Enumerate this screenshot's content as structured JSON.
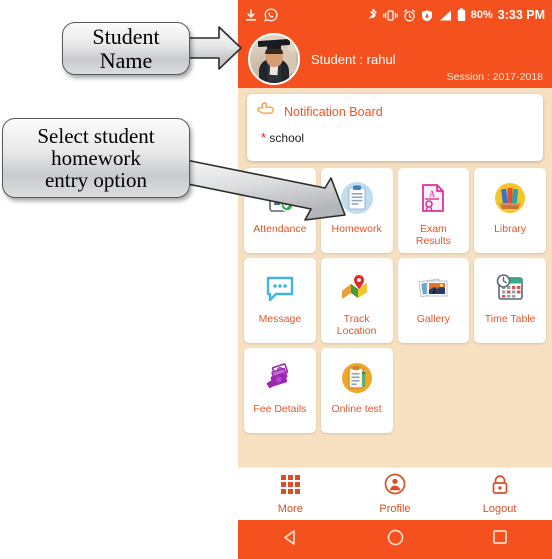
{
  "annotations": [
    {
      "id": "student-name",
      "text": "Student\nName"
    },
    {
      "id": "homework-option",
      "text": "Select student\nhomework\nentry option"
    }
  ],
  "phone": {
    "statusbar": {
      "left_icons": [
        "download-icon",
        "whatsapp-icon"
      ],
      "right_icons": [
        "bluetooth-icon",
        "vibrate-icon",
        "alarm-icon",
        "location-icon",
        "signal-icon",
        "battery-icon"
      ],
      "battery": "80%",
      "time": "3:33 PM"
    },
    "header": {
      "avatar": "graduate-photo",
      "student_label": "Student : rahul",
      "session_label": "Session : 2017-2018",
      "background_color": "#f4511e"
    },
    "notification_board": {
      "icon": "pointing-hand-icon",
      "title": "Notification Board",
      "items": [
        {
          "bullet": "*",
          "text": "school"
        }
      ]
    },
    "tiles": [
      {
        "label": "Attendance",
        "icon": "attendance-icon"
      },
      {
        "label": "Homework",
        "icon": "homework-icon"
      },
      {
        "label": "Exam\nResults",
        "icon": "exam-results-icon"
      },
      {
        "label": "Library",
        "icon": "library-icon"
      },
      {
        "label": "Message",
        "icon": "message-icon"
      },
      {
        "label": "Track\nLocation",
        "icon": "track-location-icon"
      },
      {
        "label": "Gallery",
        "icon": "gallery-icon"
      },
      {
        "label": "Time Table",
        "icon": "time-table-icon"
      },
      {
        "label": "Fee Details",
        "icon": "fee-details-icon"
      },
      {
        "label": "Online test",
        "icon": "online-test-icon"
      }
    ],
    "bottom_nav": [
      {
        "label": "More",
        "icon": "grid-icon"
      },
      {
        "label": "Profile",
        "icon": "profile-icon"
      },
      {
        "label": "Logout",
        "icon": "lock-icon"
      }
    ],
    "android_nav": [
      {
        "icon": "back-icon"
      },
      {
        "icon": "home-icon"
      },
      {
        "icon": "recents-icon"
      }
    ],
    "colors": {
      "accent": "#f4511e",
      "background": "#f6e0c0",
      "tile_label": "#e2562b"
    }
  }
}
